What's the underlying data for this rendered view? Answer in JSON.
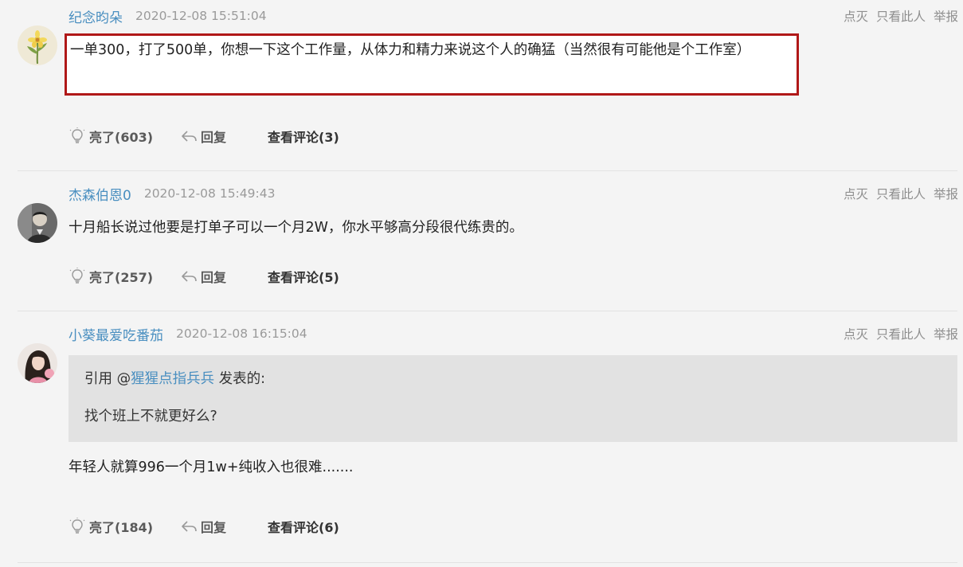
{
  "comments": [
    {
      "username": "纪念昀朵",
      "time": "2020-12-08 15:51:04",
      "ops": [
        "点灭",
        "只看此人",
        "举报"
      ],
      "text": "一单300，打了500单，你想一下这个工作量，从体力和精力来说这个人的确猛（当然很有可能他是个工作室）",
      "like_label": "亮了(603)",
      "reply_label": "回复",
      "view_label": "查看评论(3)"
    },
    {
      "username": "杰森伯恩0",
      "time": "2020-12-08 15:49:43",
      "ops": [
        "点灭",
        "只看此人",
        "举报"
      ],
      "text": "十月船长说过他要是打单子可以一个月2W，你水平够高分段很代练贵的。",
      "like_label": "亮了(257)",
      "reply_label": "回复",
      "view_label": "查看评论(5)"
    },
    {
      "username": "小葵最爱吃番茄",
      "time": "2020-12-08 16:15:04",
      "ops": [
        "点灭",
        "只看此人",
        "举报"
      ],
      "quote": {
        "prefix": "引用 @",
        "quoted_user": "猩猩点指兵兵",
        "suffix": " 发表的:",
        "text": "找个班上不就更好么?"
      },
      "text": "年轻人就算996一个月1w+纯收入也很难.......",
      "like_label": "亮了(184)",
      "reply_label": "回复",
      "view_label": "查看评论(6)"
    }
  ],
  "colors": {
    "username": "#4a8fc0",
    "highlight_border": "#b01818",
    "quote_bg": "#e2e2e2",
    "page_bg": "#f4f4f4"
  }
}
